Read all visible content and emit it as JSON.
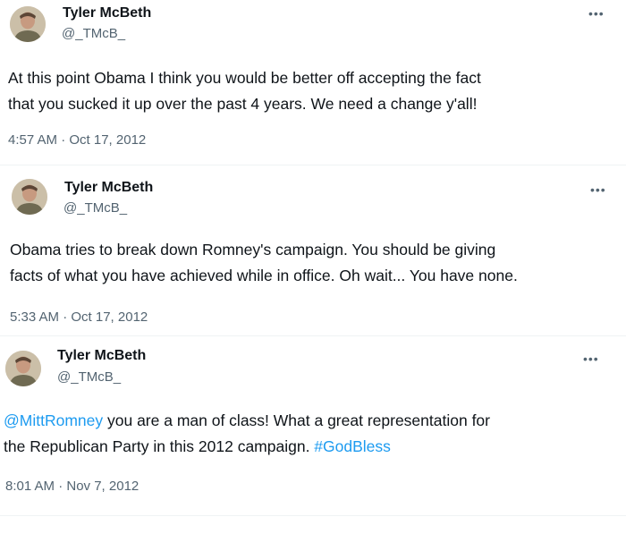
{
  "tweets": [
    {
      "author_name": "Tyler McBeth",
      "author_handle": "@_TMcB_",
      "line1": "At this point Obama I think you would be better off accepting the fact",
      "line2": "that you sucked it up over the past 4 years. We need a change y'all!",
      "timestamp": "4:57 AM · Oct 17, 2012",
      "more_icon": "more-horizontal-icon"
    },
    {
      "author_name": "Tyler McBeth",
      "author_handle": "@_TMcB_",
      "line1": "Obama tries to break down Romney's campaign. You should be giving",
      "line2": "facts of what you have achieved while in office. Oh wait... You have none.",
      "timestamp": "5:33 AM · Oct 17, 2012",
      "more_icon": "more-horizontal-icon"
    },
    {
      "author_name": "Tyler McBeth",
      "author_handle": "@_TMcB_",
      "mention": "@MittRomney",
      "line1_rest": " you are a man of class! What a great representation for",
      "line2_text": "the Republican Party in this 2012 campaign. ",
      "hashtag": "#GodBless",
      "timestamp": "8:01 AM · Nov 7, 2012",
      "more_icon": "more-horizontal-icon"
    }
  ],
  "colors": {
    "text": "#0f1419",
    "secondary": "#536471",
    "link": "#1d9bf0"
  }
}
